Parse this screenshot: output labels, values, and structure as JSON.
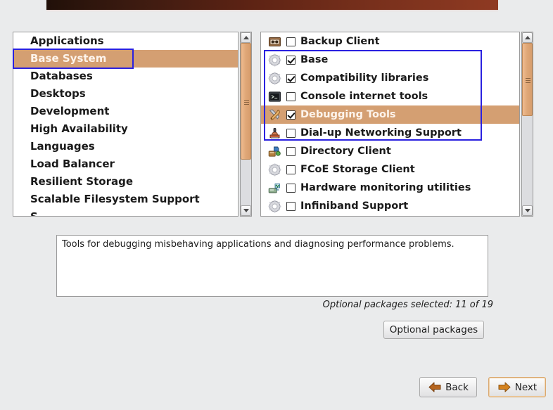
{
  "window": {
    "banner_color": "#5d2314",
    "background_color": "#eaebec",
    "selection_color": "#d49f72",
    "annotation_color": "#2a21e0"
  },
  "category_list": {
    "name": "package-group-categories",
    "items": [
      {
        "label": "Applications",
        "selected": false
      },
      {
        "label": "Base System",
        "selected": true
      },
      {
        "label": "Databases",
        "selected": false
      },
      {
        "label": "Desktops",
        "selected": false
      },
      {
        "label": "Development",
        "selected": false
      },
      {
        "label": "High Availability",
        "selected": false
      },
      {
        "label": "Languages",
        "selected": false
      },
      {
        "label": "Load Balancer",
        "selected": false
      },
      {
        "label": "Resilient Storage",
        "selected": false
      },
      {
        "label": "Scalable Filesystem Support",
        "selected": false
      },
      {
        "label": "S",
        "selected": false
      }
    ],
    "scrollbar": {
      "up_arrow": "scroll-up-arrow",
      "down_arrow": "scroll-down-arrow",
      "thumb_top_percent": 0,
      "thumb_height_percent": 72
    }
  },
  "package_list": {
    "name": "package-group-items",
    "items": [
      {
        "label": "Backup Client",
        "checked": false,
        "selected": false,
        "icon": "backup-drive-icon"
      },
      {
        "label": "Base",
        "checked": true,
        "selected": false,
        "icon": "gear-icon"
      },
      {
        "label": "Compatibility libraries",
        "checked": true,
        "selected": false,
        "icon": "gear-icon"
      },
      {
        "label": "Console internet tools",
        "checked": false,
        "selected": false,
        "icon": "terminal-icon"
      },
      {
        "label": "Debugging Tools",
        "checked": true,
        "selected": true,
        "icon": "tools-icon"
      },
      {
        "label": "Dial-up Networking Support",
        "checked": false,
        "selected": false,
        "icon": "telephone-icon"
      },
      {
        "label": "Directory Client",
        "checked": false,
        "selected": false,
        "icon": "directory-icon"
      },
      {
        "label": "FCoE Storage Client",
        "checked": false,
        "selected": false,
        "icon": "gear-icon"
      },
      {
        "label": "Hardware monitoring utilities",
        "checked": false,
        "selected": false,
        "icon": "hardware-monitor-icon"
      },
      {
        "label": "Infiniband Support",
        "checked": false,
        "selected": false,
        "icon": "gear-icon"
      }
    ],
    "scrollbar": {
      "up_arrow": "scroll-up-arrow",
      "down_arrow": "scroll-down-arrow",
      "thumb_top_percent": 0,
      "thumb_height_percent": 45
    }
  },
  "description": {
    "text": "Tools for debugging misbehaving applications and diagnosing performance problems."
  },
  "optional_summary": {
    "text": "Optional packages selected: 11 of 19"
  },
  "buttons": {
    "optional_packages": "Optional packages",
    "back": "Back",
    "next": "Next"
  }
}
